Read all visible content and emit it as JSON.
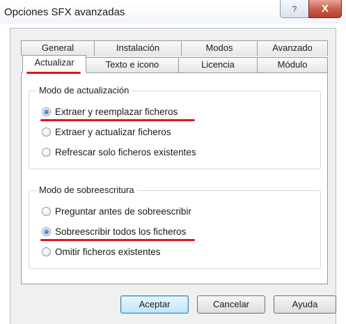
{
  "window": {
    "title": "Opciones SFX avanzadas",
    "help_glyph": "?",
    "close_glyph": "X"
  },
  "tabs": {
    "row1": [
      "General",
      "Instalación",
      "Modos",
      "Avanzado"
    ],
    "row2": [
      "Actualizar",
      "Texto e icono",
      "Licencia",
      "Módulo"
    ],
    "active": "Actualizar"
  },
  "update_mode": {
    "title": "Modo de actualización",
    "options": [
      {
        "label": "Extraer y reemplazar ficheros",
        "selected": true
      },
      {
        "label": "Extraer y actualizar ficheros",
        "selected": false
      },
      {
        "label": "Refrescar solo ficheros existentes",
        "selected": false
      }
    ]
  },
  "overwrite_mode": {
    "title": "Modo de sobreescritura",
    "options": [
      {
        "label": "Preguntar antes de sobreescribir",
        "selected": false
      },
      {
        "label": "Sobreescribir todos los ficheros",
        "selected": true
      },
      {
        "label": "Omitir ficheros existentes",
        "selected": false
      }
    ]
  },
  "buttons": {
    "accept": "Aceptar",
    "cancel": "Cancelar",
    "help": "Ayuda"
  },
  "colors": {
    "annotation_red": "#e0141e",
    "accent_blue": "#1b57b8"
  }
}
